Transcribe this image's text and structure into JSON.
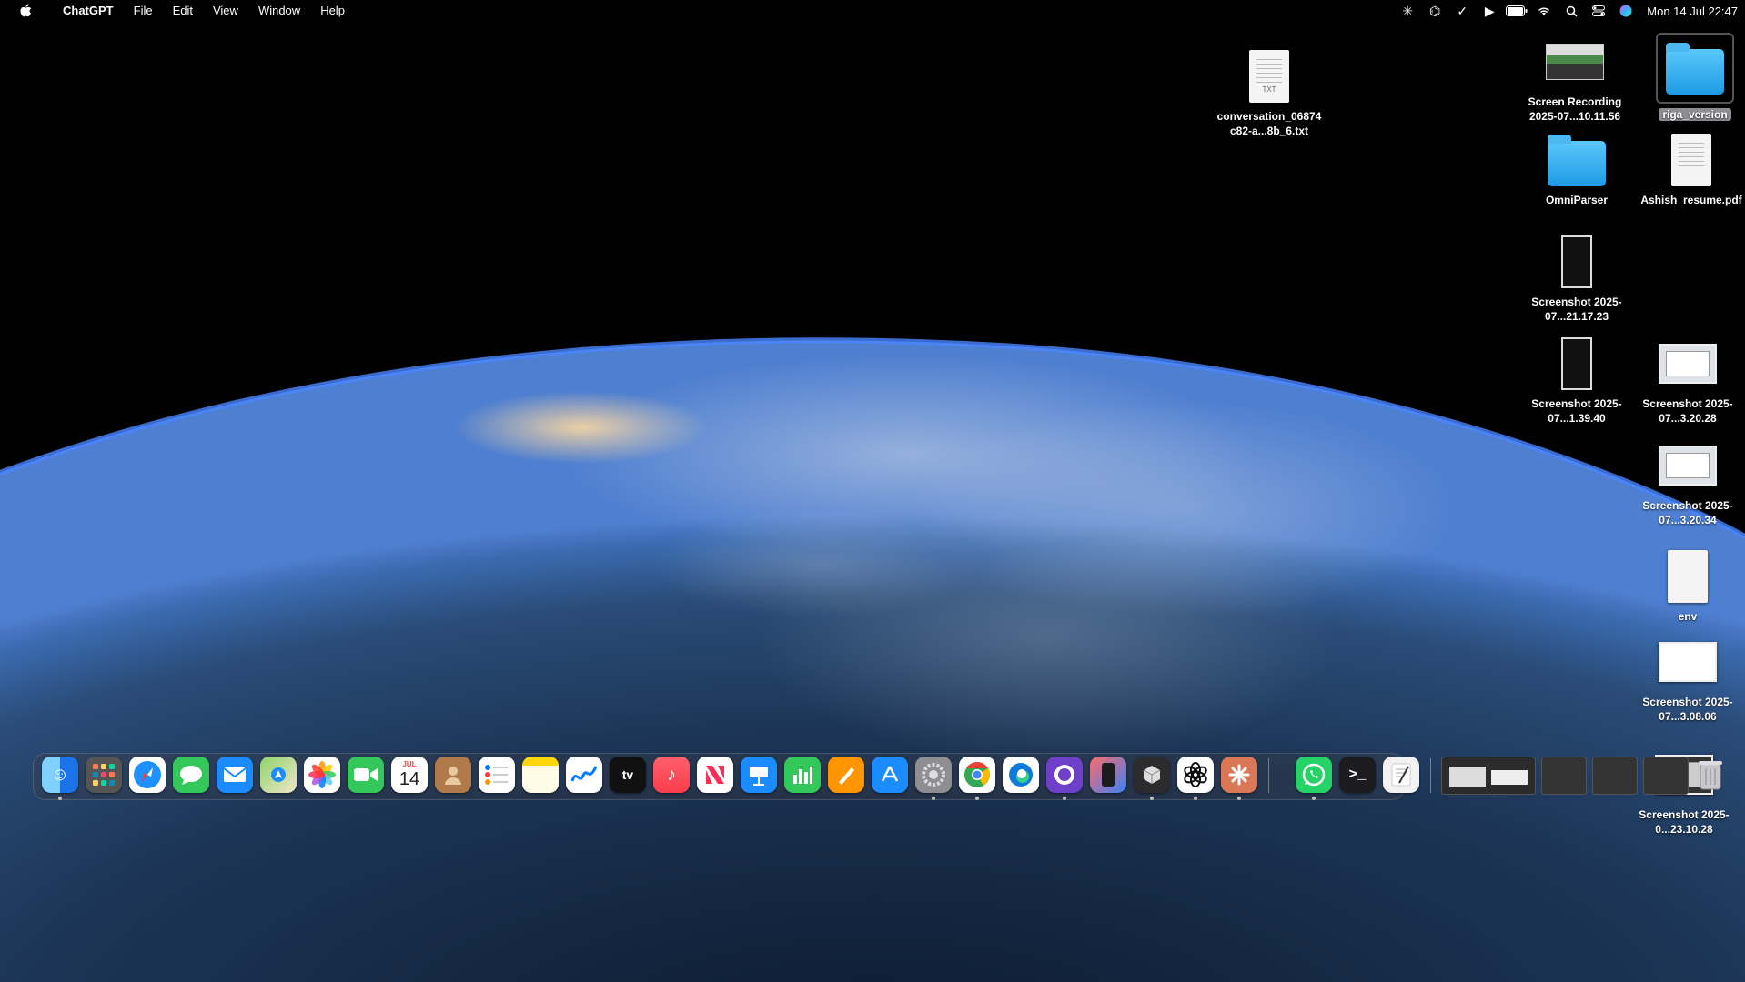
{
  "menubar": {
    "app_name": "ChatGPT",
    "items": [
      "File",
      "Edit",
      "View",
      "Window",
      "Help"
    ],
    "clock": "Mon 14 Jul  22:47",
    "status_icons": [
      "claude-icon",
      "chatgpt-icon",
      "check-icon",
      "play-icon",
      "battery-icon",
      "wifi-icon",
      "spotlight-icon",
      "control-center-icon",
      "siri-icon"
    ]
  },
  "desktop": {
    "conversation_file": {
      "name": "conversation_06874c82-a...8b_6.txt",
      "tag": "TXT"
    },
    "screen_recording": {
      "name": "Screen Recording 2025-07...10.11.56"
    },
    "riga_folder": {
      "name": "riga_version"
    },
    "omniparser_folder": {
      "name": "OmniParser"
    },
    "resume": {
      "name": "Ashish_resume.pdf"
    },
    "screenshot_a": {
      "name": "Screenshot 2025-07...21.17.23"
    },
    "screenshot_b": {
      "name": "Screenshot 2025-07...1.39.40"
    },
    "screenshot_c": {
      "name": "Screenshot 2025-07...3.20.28"
    },
    "screenshot_d": {
      "name": "Screenshot 2025-07...3.20.34"
    },
    "env_file": {
      "name": "env"
    },
    "screenshot_e": {
      "name": "Screenshot 2025-07...3.08.06"
    },
    "screenshot_f": {
      "name": "Screenshot 2025-0...23.10.28"
    }
  },
  "dock": {
    "calendar_month": "JUL",
    "calendar_day": "14",
    "tv_label": "tv"
  },
  "colors": {
    "accent": "#1e9be6"
  }
}
